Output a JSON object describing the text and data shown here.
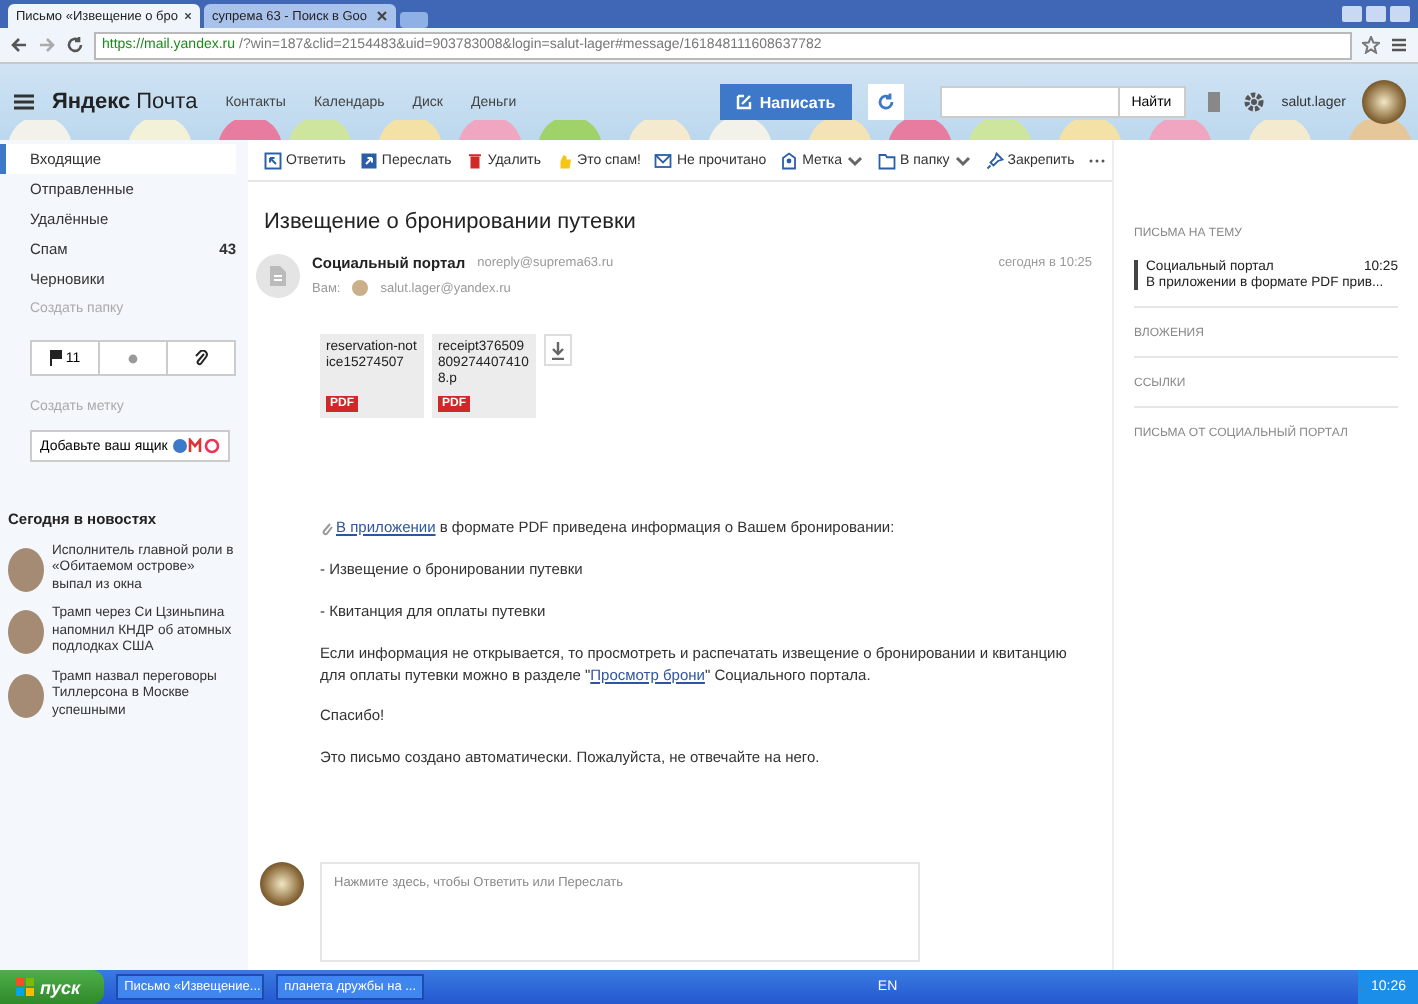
{
  "browser": {
    "tabs": [
      {
        "label": "Письмо «Извещение о бро",
        "selected": true
      },
      {
        "label": "супрема 63 - Поиск в Goo",
        "selected": false
      }
    ],
    "url_host": "https://mail.yandex.ru",
    "url_rest": "/?win=187&clid=2154483&uid=903783008&login=salut-lager#message/161848111608637782"
  },
  "header": {
    "logo_brand": "Яндекс",
    "logo_product": "Почта",
    "nav": [
      "Контакты",
      "Календарь",
      "Диск",
      "Деньги"
    ],
    "compose": "Написать",
    "search_button": "Найти",
    "username": "salut.lager"
  },
  "sidebar": {
    "folders": [
      {
        "label": "Входящие",
        "selected": true
      },
      {
        "label": "Отправленные",
        "selected": false
      },
      {
        "label": "Удалённые",
        "selected": false
      },
      {
        "label": "Спам",
        "count": "43",
        "selected": false
      },
      {
        "label": "Черновики",
        "selected": false
      }
    ],
    "create_folder": "Создать папку",
    "filters": [
      {
        "kind": "flag",
        "count": "11"
      },
      {
        "kind": "dot"
      },
      {
        "kind": "clip"
      }
    ],
    "create_label": "Создать метку",
    "add_mailbox": "Добавьте ваш ящик",
    "news_title": "Сегодня в новостях",
    "news": [
      "Исполнитель главной роли в «Обитаемом острове» выпал из окна",
      "Трамп через Си Цзиньпина напомнил КНДР об атомных подлодках США",
      "Трамп назвал переговоры Тиллерсона в Москве успешными"
    ]
  },
  "toolbar": [
    {
      "kind": "reply",
      "label": "Ответить",
      "dropdown": false
    },
    {
      "kind": "forward",
      "label": "Переслать",
      "dropdown": false
    },
    {
      "kind": "delete",
      "label": "Удалить",
      "dropdown": false
    },
    {
      "kind": "spam",
      "label": "Это спам!",
      "dropdown": false
    },
    {
      "kind": "unread",
      "label": "Не прочитано",
      "dropdown": false
    },
    {
      "kind": "label",
      "label": "Метка",
      "dropdown": true
    },
    {
      "kind": "folder",
      "label": "В папку",
      "dropdown": true
    },
    {
      "kind": "pin",
      "label": "Закрепить",
      "dropdown": false
    },
    {
      "kind": "more",
      "dropdown": false
    }
  ],
  "message": {
    "subject": "Извещение о бронировании путевки",
    "sender": "Социальный портал",
    "sender_email": "noreply@suprema63.ru",
    "to_label": "Вам:",
    "to": "salut.lager@yandex.ru",
    "date": "сегодня в 10:25",
    "attachments": [
      {
        "name": "reservation-notice15274507",
        "type": "PDF"
      },
      {
        "name": "receipt3765098092744074108.p",
        "type": "PDF"
      }
    ],
    "body": [
      {
        "kind": "attachment_link",
        "link": "В приложении",
        "text": " в формате PDF приведена информация о Вашем бронировании:"
      },
      {
        "kind": "text",
        "text": "- Извещение о бронировании путевки"
      },
      {
        "kind": "text",
        "text": "- Квитанция для оплаты путевки"
      },
      {
        "kind": "link_inline",
        "before": "Если информация не открывается, то просмотреть и распечатать извещение о бронировании и квитанцию для оплаты путевки можно в разделе \"",
        "link": "Просмотр брони",
        "after": "\" Социального портала."
      },
      {
        "kind": "text",
        "text": "Спасибо!"
      },
      {
        "kind": "text",
        "text": "Это письмо создано автоматически. Пожалуйста, не отвечайте на него."
      }
    ],
    "reply_placeholder": "Нажмите здесь, чтобы Ответить или Переслать"
  },
  "right_panel": {
    "thread_title": "ПИСЬМА НА ТЕМУ",
    "thread_item": {
      "sender": "Социальный портал",
      "time": "10:25",
      "snippet": "В приложении в формате PDF прив..."
    },
    "sections": [
      "ВЛОЖЕНИЯ",
      "ССЫЛКИ",
      "ПИСЬМА ОТ СОЦИАЛЬНЫЙ ПОРТАЛ"
    ]
  },
  "taskbar": {
    "start": "пуск",
    "tasks": [
      "Письмо «Извещение...",
      "планета дружбы на ..."
    ],
    "language": "EN",
    "clock": "10:26"
  }
}
